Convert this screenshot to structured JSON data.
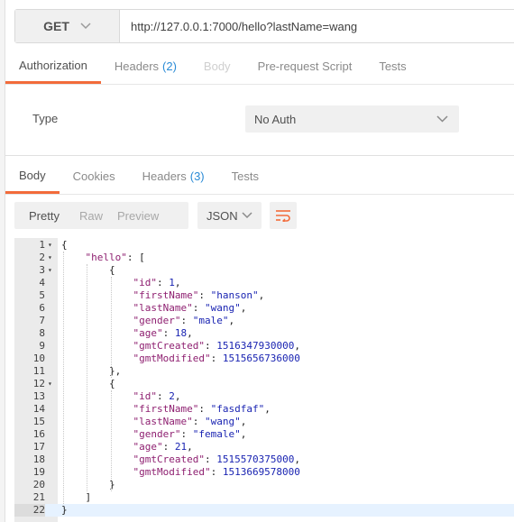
{
  "request": {
    "method": "GET",
    "url": "http://127.0.0.1:7000/hello?lastName=wang"
  },
  "request_tabs": [
    {
      "label": "Authorization",
      "count": "",
      "state": "active"
    },
    {
      "label": "Headers",
      "count": "(2)",
      "state": "normal"
    },
    {
      "label": "Body",
      "count": "",
      "state": "disabled"
    },
    {
      "label": "Pre-request Script",
      "count": "",
      "state": "normal"
    },
    {
      "label": "Tests",
      "count": "",
      "state": "normal"
    }
  ],
  "auth": {
    "type_label": "Type",
    "type_value": "No Auth"
  },
  "response_tabs": [
    {
      "label": "Body",
      "count": "",
      "state": "active"
    },
    {
      "label": "Cookies",
      "count": "",
      "state": "normal"
    },
    {
      "label": "Headers",
      "count": "(3)",
      "state": "normal"
    },
    {
      "label": "Tests",
      "count": "",
      "state": "normal"
    }
  ],
  "response_toolbar": {
    "view_modes": [
      "Pretty",
      "Raw",
      "Preview"
    ],
    "active_view": "Pretty",
    "format": "JSON",
    "wrap_icon": "wrap-lines-icon"
  },
  "colors": {
    "accent": "#f26b3a",
    "count": "#2a8bd6",
    "json_key": "#8e1f70",
    "json_value": "#1a24b2"
  },
  "code": {
    "current_line": 22,
    "lines": [
      {
        "n": "1",
        "fold": true,
        "tokens": [
          [
            "p",
            "{"
          ]
        ]
      },
      {
        "n": "2",
        "fold": true,
        "tokens": [
          [
            "p",
            "    "
          ],
          [
            "k",
            "\"hello\""
          ],
          [
            "p",
            ": ["
          ]
        ]
      },
      {
        "n": "3",
        "fold": true,
        "tokens": [
          [
            "p",
            "        {"
          ]
        ]
      },
      {
        "n": "4",
        "fold": false,
        "tokens": [
          [
            "p",
            "            "
          ],
          [
            "k",
            "\"id\""
          ],
          [
            "p",
            ": "
          ],
          [
            "n",
            "1"
          ],
          [
            "p",
            ","
          ]
        ]
      },
      {
        "n": "5",
        "fold": false,
        "tokens": [
          [
            "p",
            "            "
          ],
          [
            "k",
            "\"firstName\""
          ],
          [
            "p",
            ": "
          ],
          [
            "s",
            "\"hanson\""
          ],
          [
            "p",
            ","
          ]
        ]
      },
      {
        "n": "6",
        "fold": false,
        "tokens": [
          [
            "p",
            "            "
          ],
          [
            "k",
            "\"lastName\""
          ],
          [
            "p",
            ": "
          ],
          [
            "s",
            "\"wang\""
          ],
          [
            "p",
            ","
          ]
        ]
      },
      {
        "n": "7",
        "fold": false,
        "tokens": [
          [
            "p",
            "            "
          ],
          [
            "k",
            "\"gender\""
          ],
          [
            "p",
            ": "
          ],
          [
            "s",
            "\"male\""
          ],
          [
            "p",
            ","
          ]
        ]
      },
      {
        "n": "8",
        "fold": false,
        "tokens": [
          [
            "p",
            "            "
          ],
          [
            "k",
            "\"age\""
          ],
          [
            "p",
            ": "
          ],
          [
            "n",
            "18"
          ],
          [
            "p",
            ","
          ]
        ]
      },
      {
        "n": "9",
        "fold": false,
        "tokens": [
          [
            "p",
            "            "
          ],
          [
            "k",
            "\"gmtCreated\""
          ],
          [
            "p",
            ": "
          ],
          [
            "n",
            "1516347930000"
          ],
          [
            "p",
            ","
          ]
        ]
      },
      {
        "n": "10",
        "fold": false,
        "tokens": [
          [
            "p",
            "            "
          ],
          [
            "k",
            "\"gmtModified\""
          ],
          [
            "p",
            ": "
          ],
          [
            "n",
            "1515656736000"
          ]
        ]
      },
      {
        "n": "11",
        "fold": false,
        "tokens": [
          [
            "p",
            "        },"
          ]
        ]
      },
      {
        "n": "12",
        "fold": true,
        "tokens": [
          [
            "p",
            "        {"
          ]
        ]
      },
      {
        "n": "13",
        "fold": false,
        "tokens": [
          [
            "p",
            "            "
          ],
          [
            "k",
            "\"id\""
          ],
          [
            "p",
            ": "
          ],
          [
            "n",
            "2"
          ],
          [
            "p",
            ","
          ]
        ]
      },
      {
        "n": "14",
        "fold": false,
        "tokens": [
          [
            "p",
            "            "
          ],
          [
            "k",
            "\"firstName\""
          ],
          [
            "p",
            ": "
          ],
          [
            "s",
            "\"fasdfaf\""
          ],
          [
            "p",
            ","
          ]
        ]
      },
      {
        "n": "15",
        "fold": false,
        "tokens": [
          [
            "p",
            "            "
          ],
          [
            "k",
            "\"lastName\""
          ],
          [
            "p",
            ": "
          ],
          [
            "s",
            "\"wang\""
          ],
          [
            "p",
            ","
          ]
        ]
      },
      {
        "n": "16",
        "fold": false,
        "tokens": [
          [
            "p",
            "            "
          ],
          [
            "k",
            "\"gender\""
          ],
          [
            "p",
            ": "
          ],
          [
            "s",
            "\"female\""
          ],
          [
            "p",
            ","
          ]
        ]
      },
      {
        "n": "17",
        "fold": false,
        "tokens": [
          [
            "p",
            "            "
          ],
          [
            "k",
            "\"age\""
          ],
          [
            "p",
            ": "
          ],
          [
            "n",
            "21"
          ],
          [
            "p",
            ","
          ]
        ]
      },
      {
        "n": "18",
        "fold": false,
        "tokens": [
          [
            "p",
            "            "
          ],
          [
            "k",
            "\"gmtCreated\""
          ],
          [
            "p",
            ": "
          ],
          [
            "n",
            "1515570375000"
          ],
          [
            "p",
            ","
          ]
        ]
      },
      {
        "n": "19",
        "fold": false,
        "tokens": [
          [
            "p",
            "            "
          ],
          [
            "k",
            "\"gmtModified\""
          ],
          [
            "p",
            ": "
          ],
          [
            "n",
            "1513669578000"
          ]
        ]
      },
      {
        "n": "20",
        "fold": false,
        "tokens": [
          [
            "p",
            "        }"
          ]
        ]
      },
      {
        "n": "21",
        "fold": false,
        "tokens": [
          [
            "p",
            "    ]"
          ]
        ]
      },
      {
        "n": "22",
        "fold": false,
        "tokens": [
          [
            "p",
            "}"
          ]
        ]
      }
    ]
  }
}
